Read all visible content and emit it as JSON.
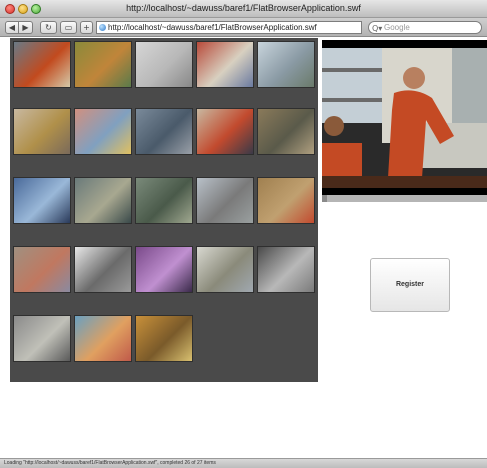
{
  "window": {
    "title": "http://localhost/~dawuss/baref1/FlatBrowserApplication.swf"
  },
  "toolbar": {
    "back_icon": "◀",
    "forward_icon": "▶",
    "reload_icon": "↻",
    "bookmark_icon": "▭",
    "add_icon": "+",
    "address": "http://localhost/~dawuss/baref1/FlatBrowserApplication.swf",
    "search_placeholder": "Google",
    "search_icon": "Q▾"
  },
  "gallery": {
    "thumbnails": [
      {
        "name": "thumb-worker-orange",
        "colors": [
          "#6a7a86",
          "#c24a1e",
          "#d5c9a8"
        ]
      },
      {
        "name": "thumb-graffiti-floral",
        "colors": [
          "#8a8a3a",
          "#c0853a",
          "#5a7a4a"
        ]
      },
      {
        "name": "thumb-airplane",
        "colors": [
          "#d6d6d6",
          "#b8b8b8",
          "#888888"
        ]
      },
      {
        "name": "thumb-us-flag",
        "colors": [
          "#b84a3a",
          "#d8d0c0",
          "#6a7aa0"
        ]
      },
      {
        "name": "thumb-statue-of-liberty",
        "colors": [
          "#c8d4dc",
          "#8a9aa4",
          "#6a7a6a"
        ]
      },
      {
        "name": "thumb-golden-statue",
        "colors": [
          "#c8b8a0",
          "#b0904a",
          "#7a6a5a"
        ]
      },
      {
        "name": "thumb-graffiti-wall",
        "colors": [
          "#d09080",
          "#80a0c0",
          "#e0c060"
        ]
      },
      {
        "name": "thumb-iron-fence",
        "colors": [
          "#7a8a9a",
          "#4a5a6a",
          "#9aa0a8"
        ]
      },
      {
        "name": "thumb-men-in-office",
        "colors": [
          "#c8b8a0",
          "#c24a2e",
          "#3a3a48"
        ]
      },
      {
        "name": "thumb-tabletop-machine",
        "colors": [
          "#8a7a5a",
          "#5a5a4a",
          "#b0a080"
        ]
      },
      {
        "name": "thumb-computer-screen",
        "colors": [
          "#4a6a9a",
          "#9ab8d8",
          "#2a3a5a"
        ]
      },
      {
        "name": "thumb-glass-building",
        "colors": [
          "#6a7a7a",
          "#a8a890",
          "#3a4a4a"
        ]
      },
      {
        "name": "thumb-factory-machine",
        "colors": [
          "#7a8a7a",
          "#4a5a4a",
          "#a0a890"
        ]
      },
      {
        "name": "thumb-city-street",
        "colors": [
          "#b8c0c8",
          "#7a7a7a",
          "#9aa0a0"
        ]
      },
      {
        "name": "thumb-workshop",
        "colors": [
          "#a08050",
          "#c0a070",
          "#c24a2e"
        ]
      },
      {
        "name": "thumb-graffiti-letters",
        "colors": [
          "#a09080",
          "#c07860",
          "#8a8aa0"
        ]
      },
      {
        "name": "thumb-white-car",
        "colors": [
          "#e8e8e8",
          "#6a6a6a",
          "#9a9a9a"
        ]
      },
      {
        "name": "thumb-limo-interior",
        "colors": [
          "#7a4a8a",
          "#c090d0",
          "#3a2a4a"
        ]
      },
      {
        "name": "thumb-white-limo",
        "colors": [
          "#d8d8d0",
          "#8a8a7a",
          "#a0a8b0"
        ]
      },
      {
        "name": "thumb-limo-seats",
        "colors": [
          "#4a4a4a",
          "#b8b8b8",
          "#7a7a7a"
        ]
      },
      {
        "name": "thumb-street-pedestrian",
        "colors": [
          "#8a8a8a",
          "#c0c0b8",
          "#5a5a5a"
        ]
      },
      {
        "name": "thumb-graffiti-colorful",
        "colors": [
          "#6aa0c0",
          "#e0a060",
          "#c05a4a"
        ]
      },
      {
        "name": "thumb-license-plates",
        "colors": [
          "#c8903a",
          "#7a5a2a",
          "#d8c070"
        ]
      }
    ]
  },
  "video": {
    "progress_fraction": 0.03,
    "scene_colors": {
      "sky": "#c4cfd6",
      "shirt": "#c44a24",
      "table": "#c8c8c0"
    }
  },
  "register_button": {
    "label": "Register"
  },
  "statusbar": {
    "text": "Loading \"http://localhost/~dawuss/baref1/FlatBrowserApplication.swf\", completed 26 of 27 items"
  }
}
